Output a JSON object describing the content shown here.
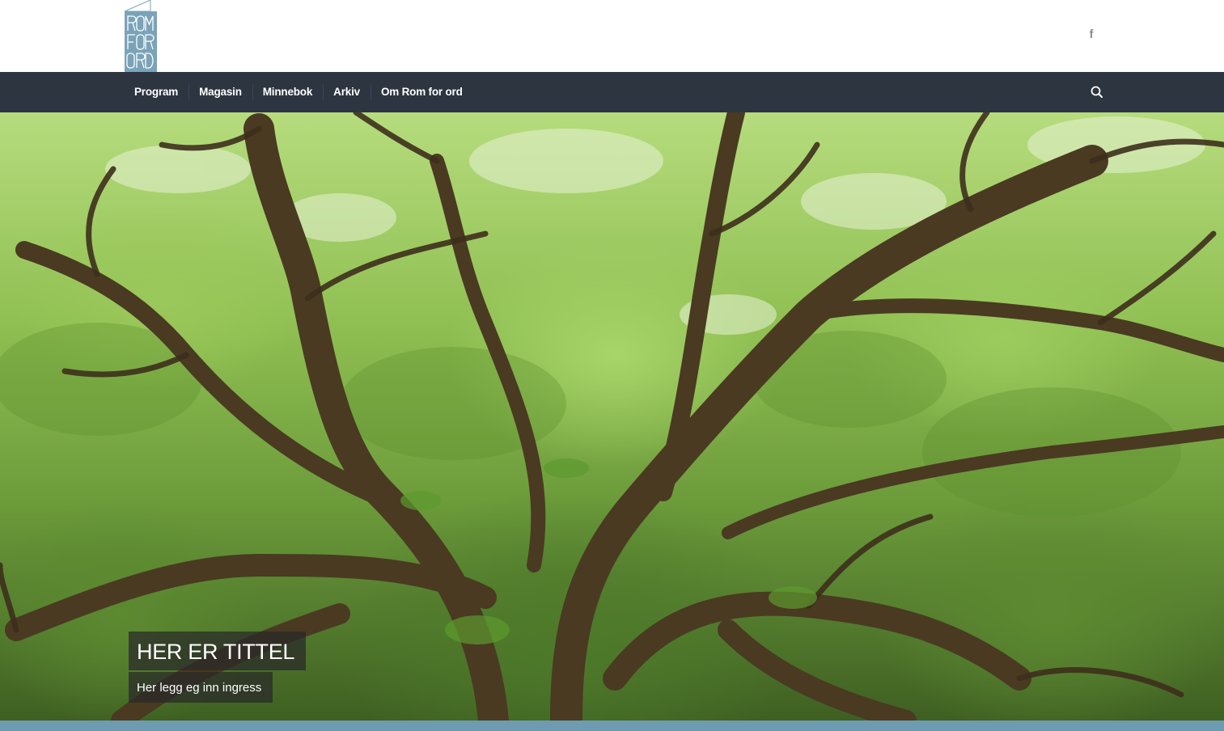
{
  "header": {
    "logo_text": [
      "ROM",
      "FOR",
      "ORD"
    ],
    "social_icon": "facebook-icon"
  },
  "nav": {
    "items": [
      {
        "label": "Program"
      },
      {
        "label": "Magasin"
      },
      {
        "label": "Minnebok"
      },
      {
        "label": "Arkiv"
      },
      {
        "label": "Om Rom for ord"
      }
    ],
    "search_icon": "search-icon"
  },
  "hero": {
    "title": "HER ER TITTEL",
    "subtitle": "Her legg eg inn ingress"
  },
  "colors": {
    "nav_bg": "#2d3540",
    "logo_bg": "#6f9bb1",
    "bottom_bar": "#6f9bb1"
  }
}
